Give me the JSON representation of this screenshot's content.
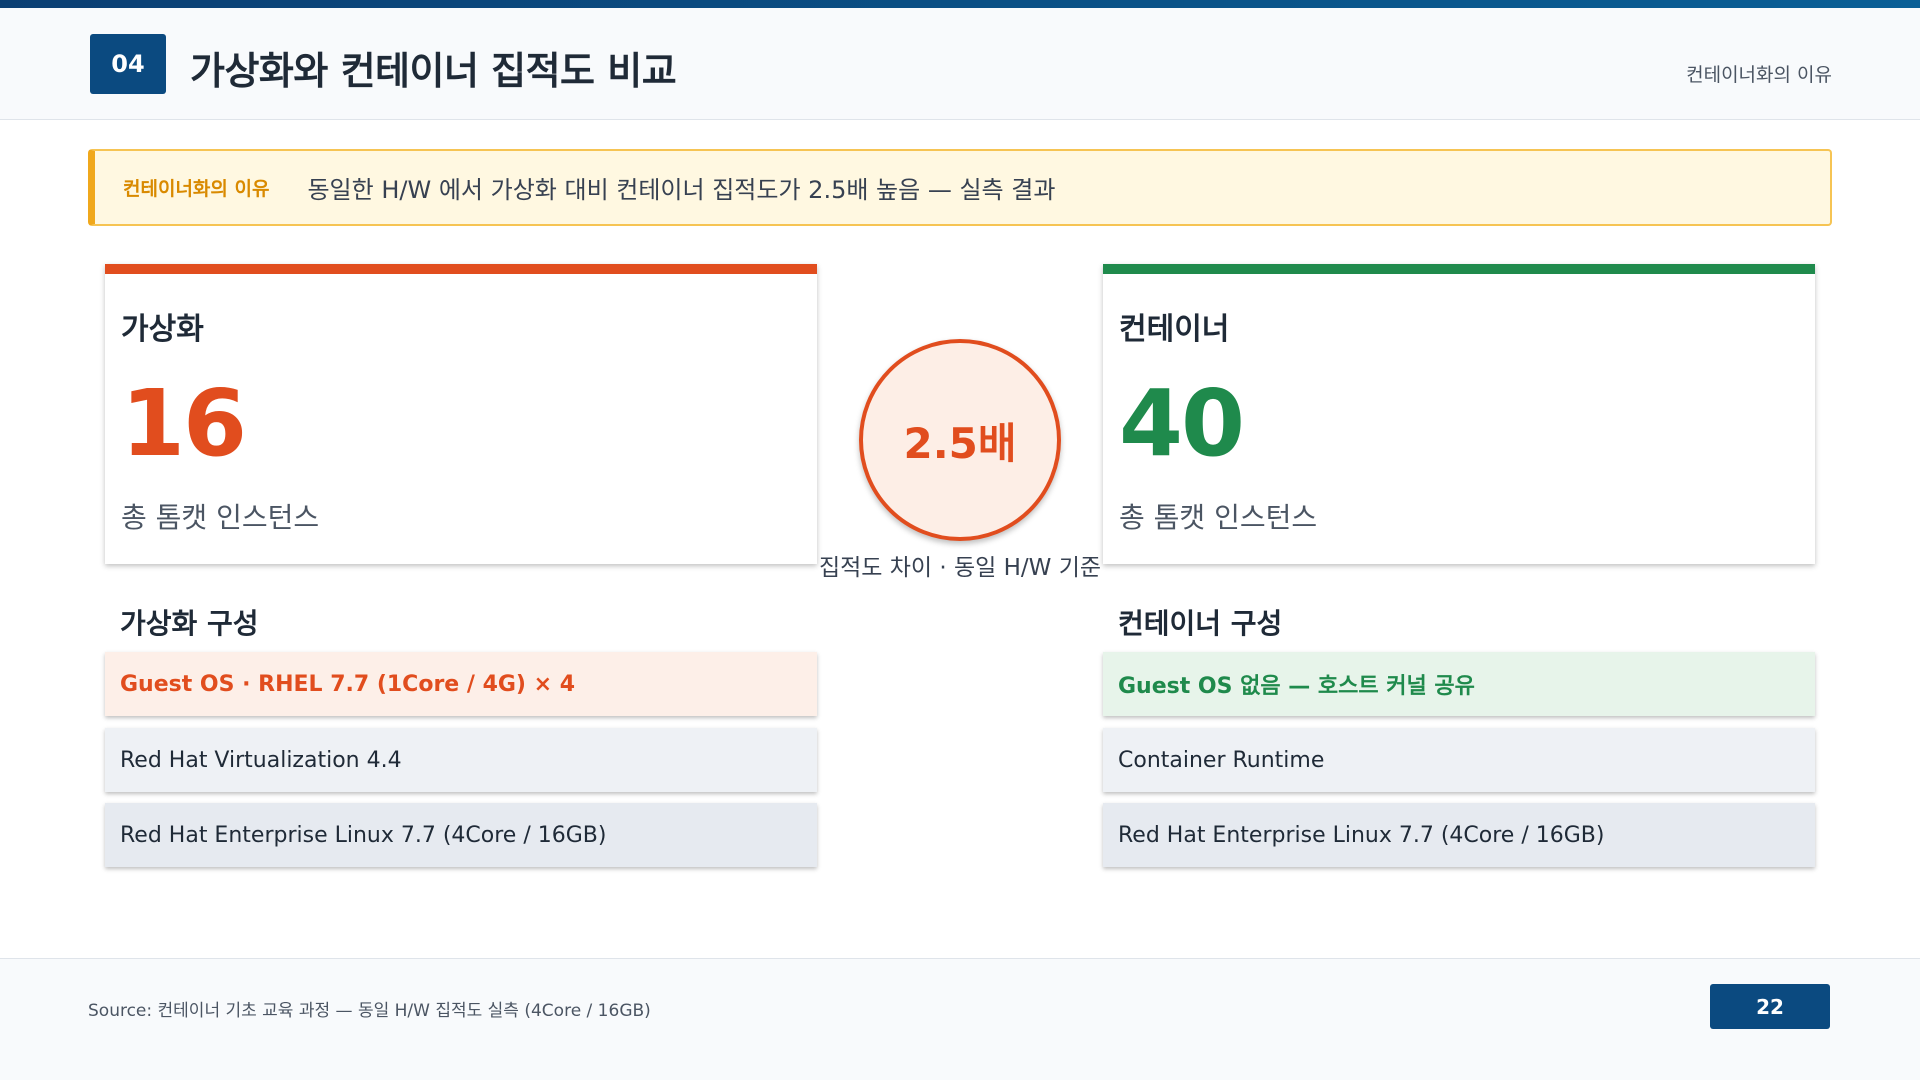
{
  "header": {
    "section_number": "04",
    "title": "가상화와 컨테이너 집적도 비교",
    "topic": "컨테이너화의 이유"
  },
  "callout": {
    "label": "컨테이너화의 이유",
    "text": "동일한 H/W 에서 가상화 대비 컨테이너 집적도가 2.5배 높음 — 실측 결과"
  },
  "virtualization": {
    "card_title": "가상화",
    "value": "16",
    "unit": "총 톰캣 인스턴스",
    "stack_title": "가상화 구성",
    "layers": [
      "Guest OS · RHEL 7.7 (1Core / 4G) × 4",
      "Red Hat Virtualization 4.4",
      "Red Hat Enterprise Linux 7.7 (4Core / 16GB)"
    ]
  },
  "container": {
    "card_title": "컨테이너",
    "value": "40",
    "unit": "총 톰캣 인스턴스",
    "stack_title": "컨테이너 구성",
    "layers": [
      "Guest OS 없음 — 호스트 커널 공유",
      "Container Runtime",
      "Red Hat Enterprise Linux 7.7 (4Core / 16GB)"
    ]
  },
  "comparison": {
    "ratio": "2.5배",
    "caption": "집적도 차이 · 동일 H/W 기준"
  },
  "footer": {
    "source": "Source: 컨테이너 기초 교육 과정 — 동일 H/W 집적도 실측 (4Core / 16GB)",
    "page_number": "22"
  },
  "colors": {
    "primary": "#0b4a80",
    "virtualization_accent": "#e14d1e",
    "container_accent": "#1f8a4c",
    "callout_accent": "#f0a81c"
  }
}
